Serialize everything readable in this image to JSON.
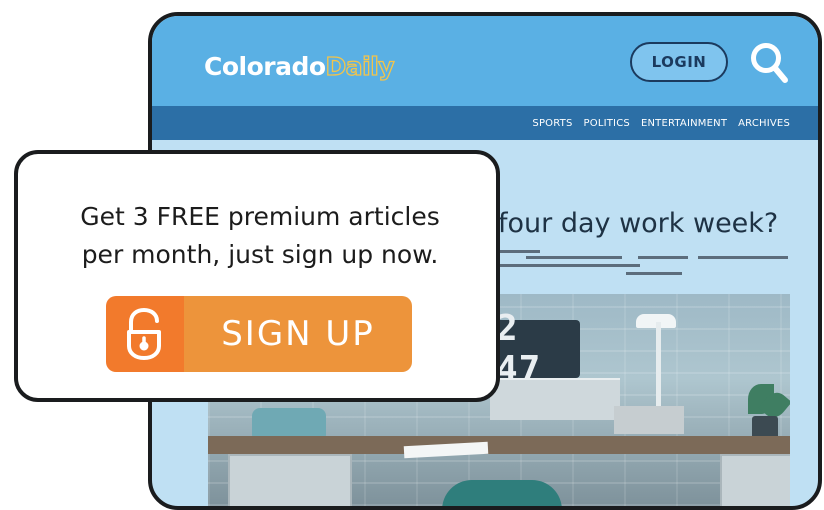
{
  "site": {
    "logo_part1": "Colorado",
    "logo_part2": "Daily",
    "login_label": "LOGIN",
    "search_icon": "search-icon",
    "nav": [
      "SPORTS",
      "POLITICS",
      "ENTERTAINMENT",
      "ARCHIVES"
    ],
    "headline": "four day work week?",
    "clock_text": "2 47"
  },
  "popup": {
    "line1": "Get 3 FREE premium articles",
    "line2": "per month, just sign up now.",
    "signup_label": "SIGN UP",
    "signup_icon": "unlock-icon"
  },
  "colors": {
    "header": "#5ab0e4",
    "navbar": "#2c6fa6",
    "page_bg": "#bfe0f3",
    "logo_accent": "#f2c44b",
    "signup_icon_bg": "#f27a2c",
    "signup_bg": "#ed943b"
  }
}
